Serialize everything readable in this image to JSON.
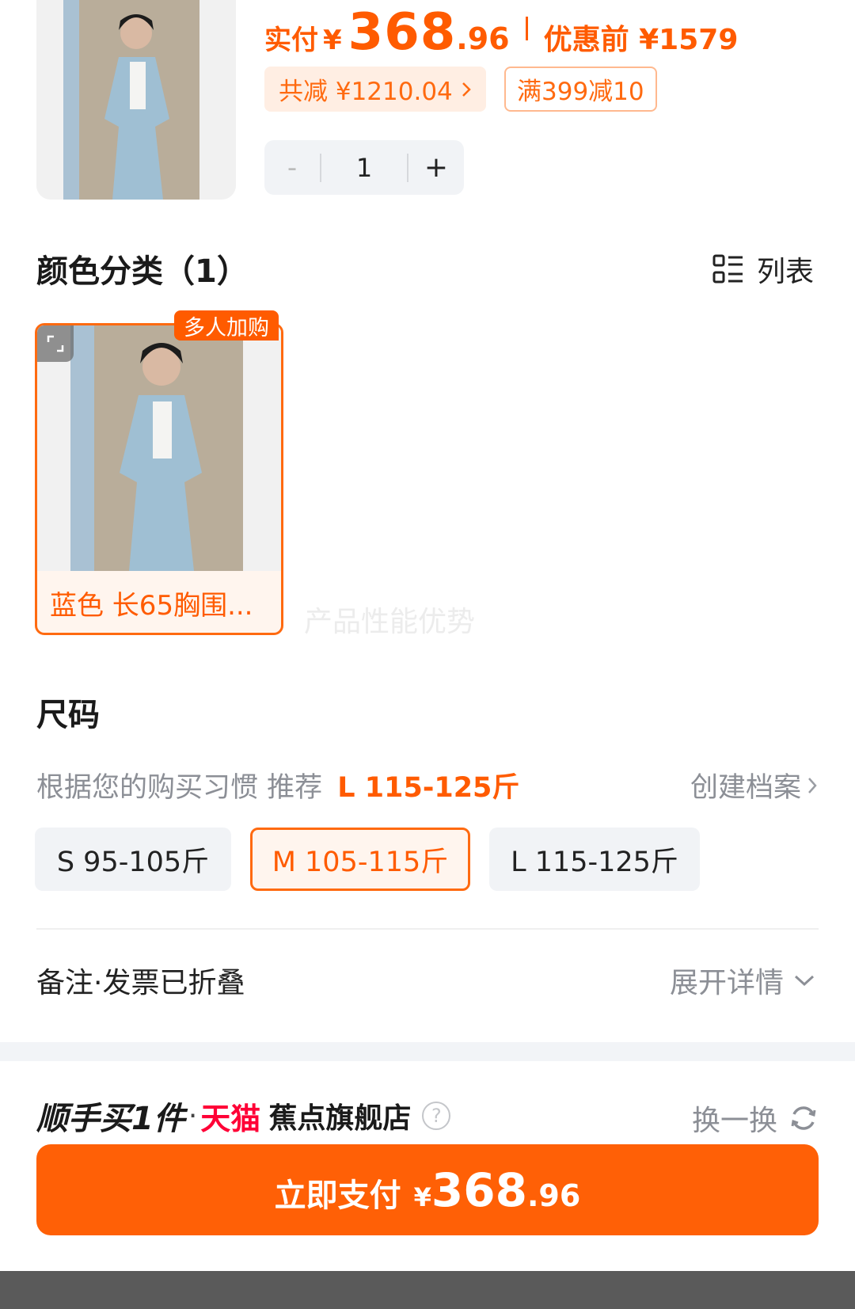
{
  "product": {
    "price_label": "实付",
    "currency": "¥",
    "price_int": "368",
    "price_dec": ".96",
    "original_price": "优惠前 ¥1579",
    "discount_tag": "共减 ¥1210.04",
    "coupon_tag": "满399减10",
    "quantity": "1",
    "minus": "-",
    "plus": "+"
  },
  "color_section": {
    "title": "颜色分类（1）",
    "view_toggle": "列表",
    "sku_name": "蓝色 长65胸围...",
    "hot_badge": "多人加购",
    "watermark": "产品性能优势"
  },
  "size_section": {
    "title": "尺码",
    "recommend_text": "根据您的购买习惯 推荐",
    "recommend_value": "L 115-125斤",
    "profile_link": "创建档案",
    "options": [
      "S 95-105斤",
      "M 105-115斤",
      "L 115-125斤"
    ],
    "selected_index": 1
  },
  "notes": {
    "label": "备注·发票已折叠",
    "expand_label": "展开详情"
  },
  "addon": {
    "title": "顺手买1件",
    "dot": "·",
    "platform": "天猫",
    "store": "蕉点旗舰店",
    "help": "?",
    "swap_label": "换一换"
  },
  "pay": {
    "label": "立即支付",
    "currency": "¥",
    "price_int": "368",
    "price_dec": ".96"
  },
  "colors": {
    "accent": "#ff6006",
    "accent_text": "#ff5b00",
    "tmall_red": "#ff0036"
  },
  "icons": {
    "list_view": "list-view-icon",
    "expand_image": "expand-icon",
    "chevron_right": "chevron-right-icon",
    "chevron_down": "chevron-down-icon",
    "refresh": "refresh-icon",
    "help": "help-circle-icon"
  }
}
